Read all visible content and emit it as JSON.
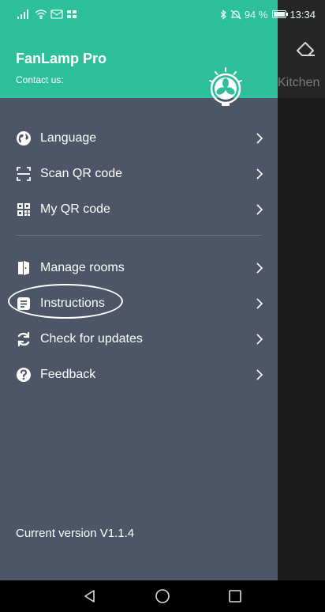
{
  "status_bar": {
    "battery": "94 %",
    "battery_level": 0.94,
    "time": "13:34"
  },
  "background": {
    "room_label": "Kitchen"
  },
  "drawer": {
    "app_name": "FanLamp Pro",
    "contact_label": "Contact us:",
    "menu_group_1": [
      {
        "label": "Language",
        "icon": "globe-icon"
      },
      {
        "label": "Scan QR code",
        "icon": "scan-icon"
      },
      {
        "label": "My QR code",
        "icon": "qr-code-icon"
      }
    ],
    "menu_group_2": [
      {
        "label": "Manage rooms",
        "icon": "door-icon"
      },
      {
        "label": "Instructions",
        "icon": "document-icon"
      },
      {
        "label": "Check for updates",
        "icon": "refresh-icon"
      },
      {
        "label": "Feedback",
        "icon": "help-icon"
      }
    ],
    "version": "Current version V1.1.4"
  },
  "colors": {
    "header": "#2cbf9a",
    "drawer": "#4d5566"
  }
}
